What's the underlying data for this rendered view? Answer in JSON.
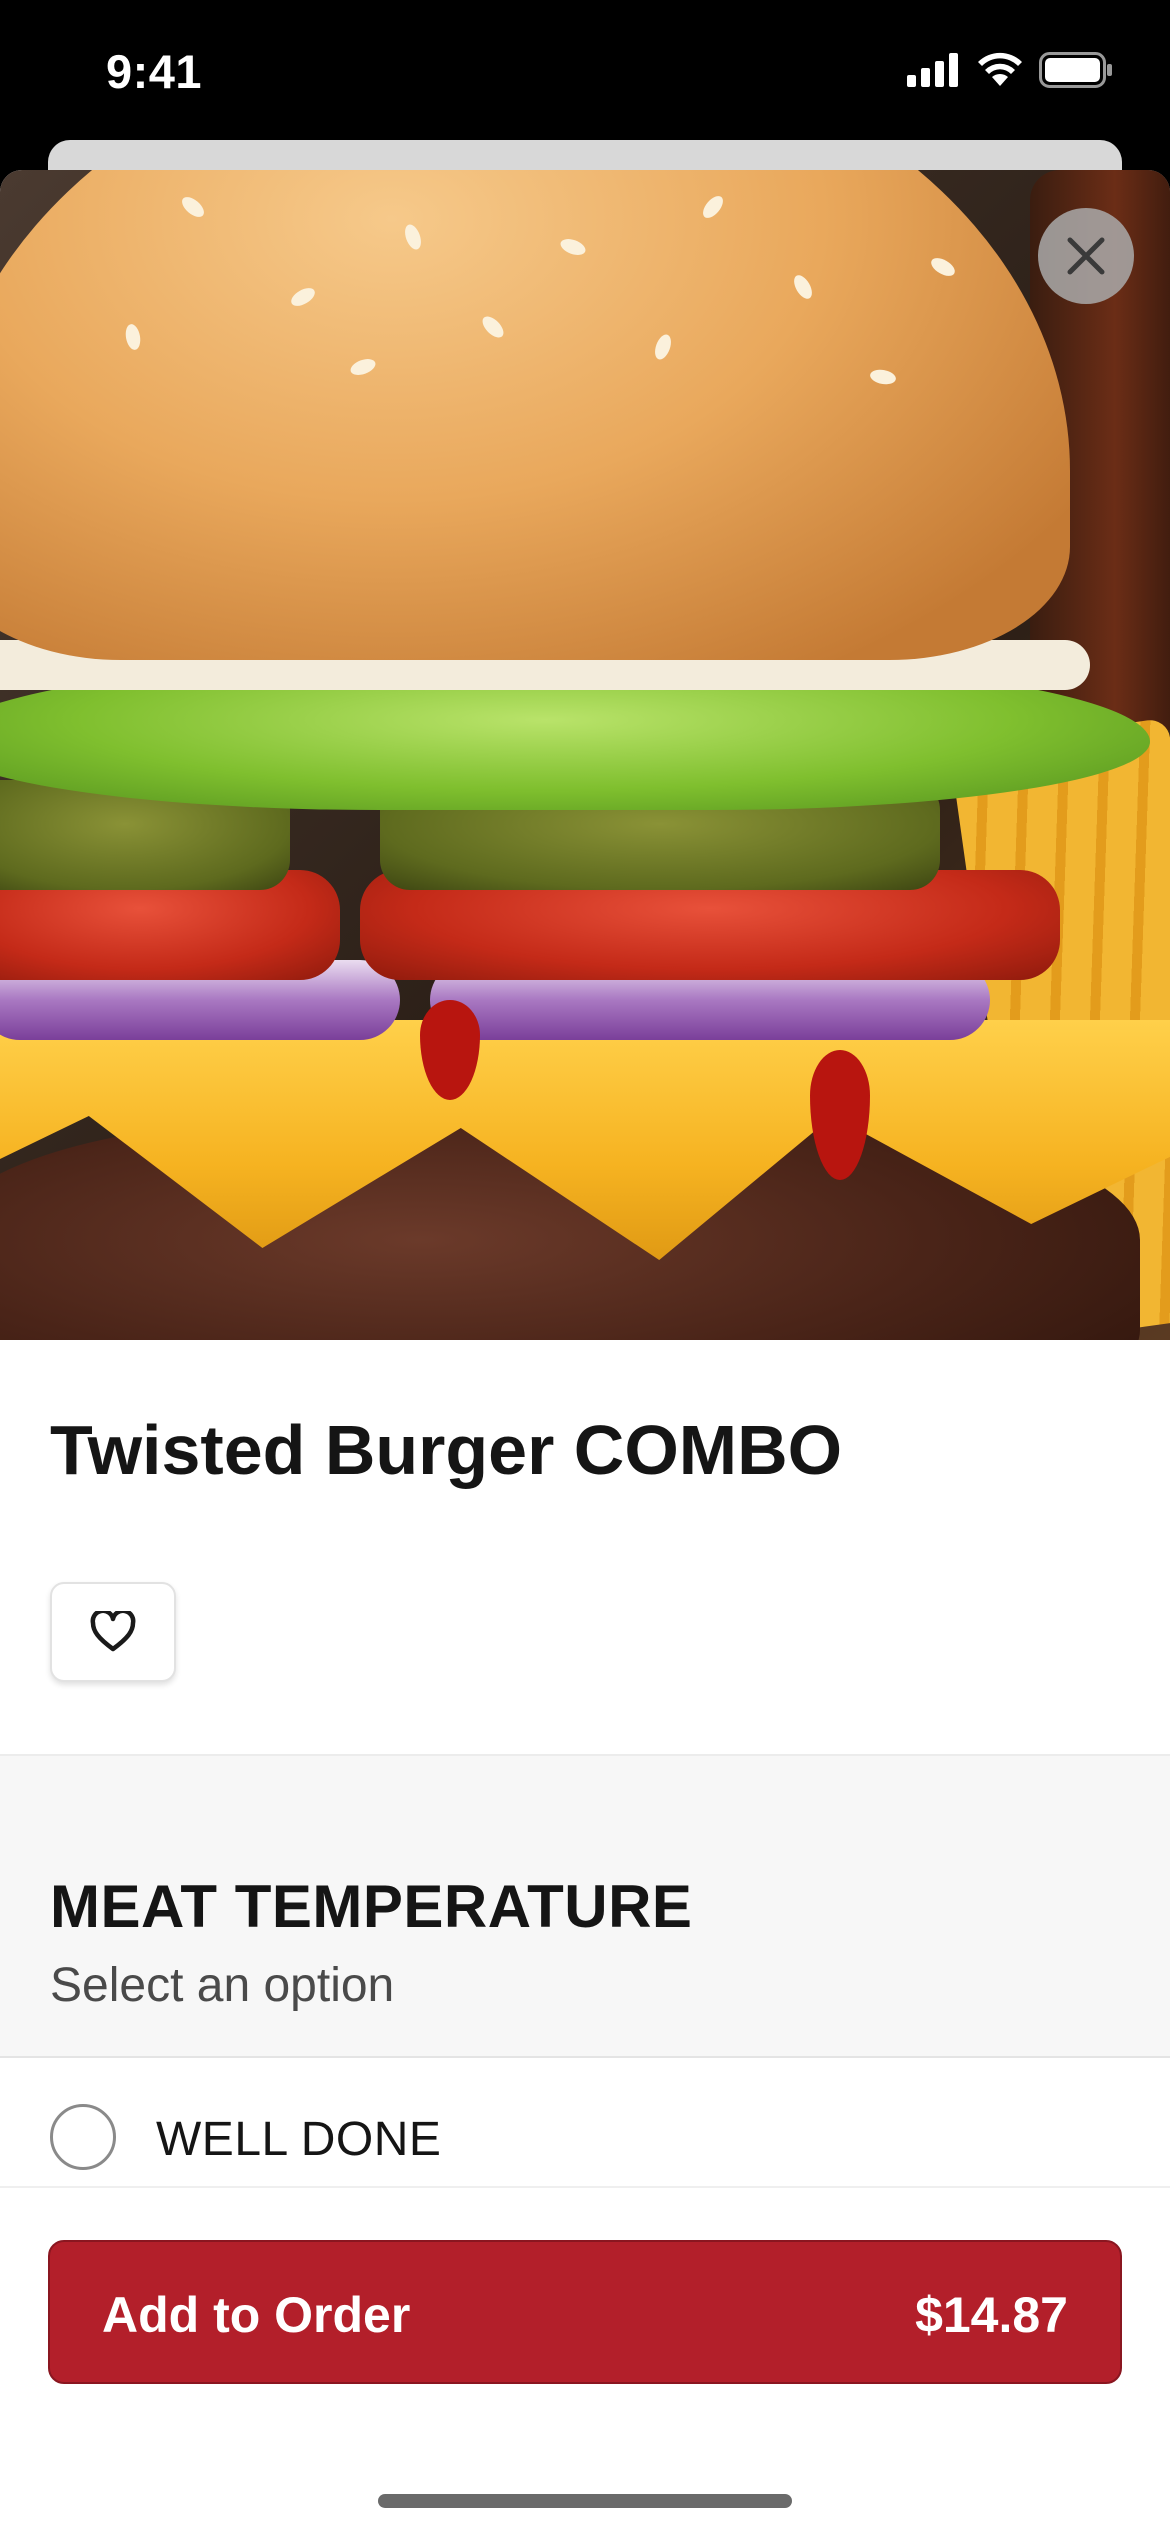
{
  "status_bar": {
    "time": "9:41",
    "icons": [
      "cellular-signal-icon",
      "wifi-icon",
      "battery-icon"
    ]
  },
  "item": {
    "title": "Twisted Burger COMBO",
    "image_alt": "Twisted Burger photo",
    "close_icon": "close-icon",
    "favorite_icon": "heart-icon"
  },
  "modifier_group": {
    "title": "MEAT TEMPERATURE",
    "subtitle": "Select an option",
    "options": [
      {
        "label": "WELL DONE",
        "selected": false
      }
    ]
  },
  "order_button": {
    "label": "Add to Order",
    "price": "$14.87"
  },
  "colors": {
    "accent": "#b31f2a",
    "text": "#151515",
    "section_bg": "#f7f7f7"
  }
}
